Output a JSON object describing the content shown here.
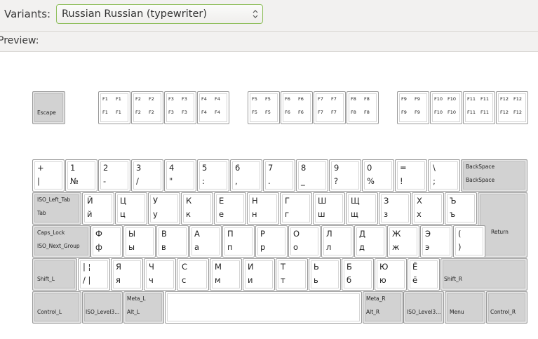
{
  "variants": {
    "label": "Variants:",
    "value": "Russian Russian (typewriter)"
  },
  "preview": {
    "label": "Preview:"
  },
  "keyboard": {
    "escape": {
      "label": "Escape"
    },
    "function_keys": [
      {
        "a": "F1",
        "b": "F1"
      },
      {
        "a": "F2",
        "b": "F2"
      },
      {
        "a": "F3",
        "b": "F3"
      },
      {
        "a": "F4",
        "b": "F4"
      },
      {
        "a": "F5",
        "b": "F5"
      },
      {
        "a": "F6",
        "b": "F6"
      },
      {
        "a": "F7",
        "b": "F7"
      },
      {
        "a": "F8",
        "b": "F8"
      },
      {
        "a": "F9",
        "b": "F9"
      },
      {
        "a": "F10",
        "b": "F10"
      },
      {
        "a": "F11",
        "b": "F11"
      },
      {
        "a": "F12",
        "b": "F12"
      }
    ],
    "row_digits": [
      {
        "top": "+",
        "bottom": "|"
      },
      {
        "top": "1",
        "bottom": "№"
      },
      {
        "top": "2",
        "bottom": "-"
      },
      {
        "top": "3",
        "bottom": "/"
      },
      {
        "top": "4",
        "bottom": "\""
      },
      {
        "top": "5",
        "bottom": ":"
      },
      {
        "top": "6",
        "bottom": ","
      },
      {
        "top": "7",
        "bottom": "."
      },
      {
        "top": "8",
        "bottom": "_"
      },
      {
        "top": "9",
        "bottom": "?"
      },
      {
        "top": "0",
        "bottom": "%"
      },
      {
        "top": "=",
        "bottom": "!"
      },
      {
        "top": "\\",
        "bottom": ";"
      }
    ],
    "backspace": {
      "top": "BackSpace",
      "bottom": "BackSpace"
    },
    "tab": {
      "top": "ISO_Left_Tab",
      "bottom": "Tab"
    },
    "row_top": [
      {
        "top": "Й",
        "bottom": "й"
      },
      {
        "top": "Ц",
        "bottom": "ц"
      },
      {
        "top": "У",
        "bottom": "у"
      },
      {
        "top": "К",
        "bottom": "к"
      },
      {
        "top": "Е",
        "bottom": "е"
      },
      {
        "top": "Н",
        "bottom": "н"
      },
      {
        "top": "Г",
        "bottom": "г"
      },
      {
        "top": "Ш",
        "bottom": "ш"
      },
      {
        "top": "Щ",
        "bottom": "щ"
      },
      {
        "top": "З",
        "bottom": "з"
      },
      {
        "top": "Х",
        "bottom": "х"
      },
      {
        "top": "Ъ",
        "bottom": "ъ"
      }
    ],
    "return": {
      "label": "Return"
    },
    "caps": {
      "top": "Caps_Lock",
      "bottom": "ISO_Next_Group"
    },
    "row_home": [
      {
        "top": "Ф",
        "bottom": "ф"
      },
      {
        "top": "Ы",
        "bottom": "ы"
      },
      {
        "top": "В",
        "bottom": "в"
      },
      {
        "top": "А",
        "bottom": "а"
      },
      {
        "top": "П",
        "bottom": "п"
      },
      {
        "top": "Р",
        "bottom": "р"
      },
      {
        "top": "О",
        "bottom": "о"
      },
      {
        "top": "Л",
        "bottom": "л"
      },
      {
        "top": "Д",
        "bottom": "д"
      },
      {
        "top": "Ж",
        "bottom": "ж"
      },
      {
        "top": "Э",
        "bottom": "э"
      },
      {
        "top": "(",
        "bottom": ")"
      }
    ],
    "shift_l": {
      "label": "Shift_L"
    },
    "row_bottom": [
      {
        "top": "| ¦",
        "bottom": "/ |"
      },
      {
        "top": "Я",
        "bottom": "я"
      },
      {
        "top": "Ч",
        "bottom": "ч"
      },
      {
        "top": "С",
        "bottom": "с"
      },
      {
        "top": "М",
        "bottom": "м"
      },
      {
        "top": "И",
        "bottom": "и"
      },
      {
        "top": "Т",
        "bottom": "т"
      },
      {
        "top": "Ь",
        "bottom": "ь"
      },
      {
        "top": "Б",
        "bottom": "б"
      },
      {
        "top": "Ю",
        "bottom": "ю"
      },
      {
        "top": "Ё",
        "bottom": "ё"
      }
    ],
    "shift_r": {
      "label": "Shift_R"
    },
    "control_l": {
      "label": "Control_L"
    },
    "level3_l": {
      "label": "ISO_Level3..."
    },
    "meta_l": {
      "top": "Meta_L",
      "bottom": "Alt_L"
    },
    "meta_r": {
      "top": "Meta_R",
      "bottom": "Alt_R"
    },
    "level3_r": {
      "label": "ISO_Level3..."
    },
    "menu": {
      "label": "Menu"
    },
    "control_r": {
      "label": "Control_R"
    }
  }
}
